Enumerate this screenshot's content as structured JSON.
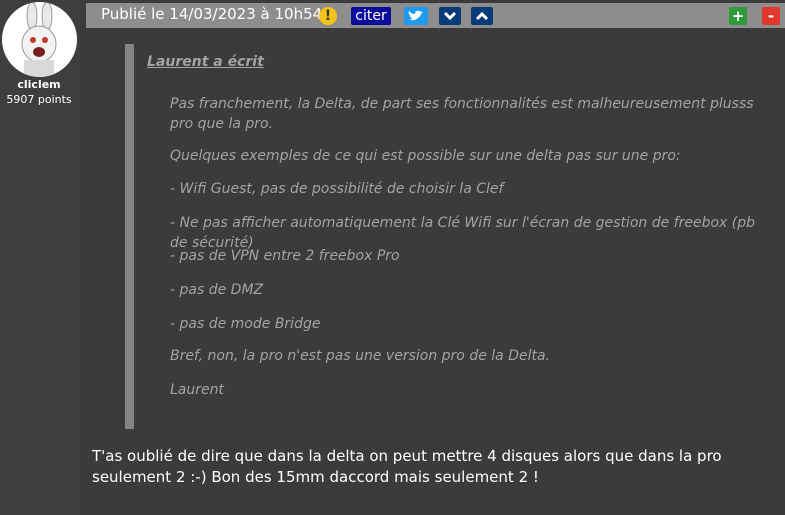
{
  "author": {
    "username": "cliclem",
    "points": "5907 points"
  },
  "header": {
    "date": "Publié le 14/03/2023 à 10h54",
    "warn_icon": "!",
    "citer": "citer",
    "plus": "+",
    "minus": "-"
  },
  "quote": {
    "author": "Laurent a écrit",
    "lines": [
      "Pas franchement, la Delta, de part ses fonctionnalités est malheureusement plusss pro que la pro.",
      "Quelques exemples de ce qui est possible sur une delta pas sur une pro:",
      "- Wifi Guest, pas de possibilité de choisir la Clef",
      "- Ne pas afficher automatiquement la Clé Wifi sur l'écran de gestion de freebox (pb de sécurité)",
      "- pas de VPN entre 2 freebox Pro",
      "- pas de DMZ",
      "- pas de mode Bridge",
      "Bref, non, la pro n'est pas une version pro de la Delta.",
      "Laurent"
    ]
  },
  "reply": "T'as oublié de dire que dans la delta on peut mettre 4 disques alors que dans la pro seulement 2 :-) Bon des 15mm daccord mais seulement 2 !",
  "colors": {
    "header_bg": "#8d8d8d",
    "citer_bg": "#0c0c9c",
    "twitter": "#1d9bf0",
    "nav": "#0b3a78",
    "plus": "#2e9a3a",
    "minus": "#e0382c"
  }
}
